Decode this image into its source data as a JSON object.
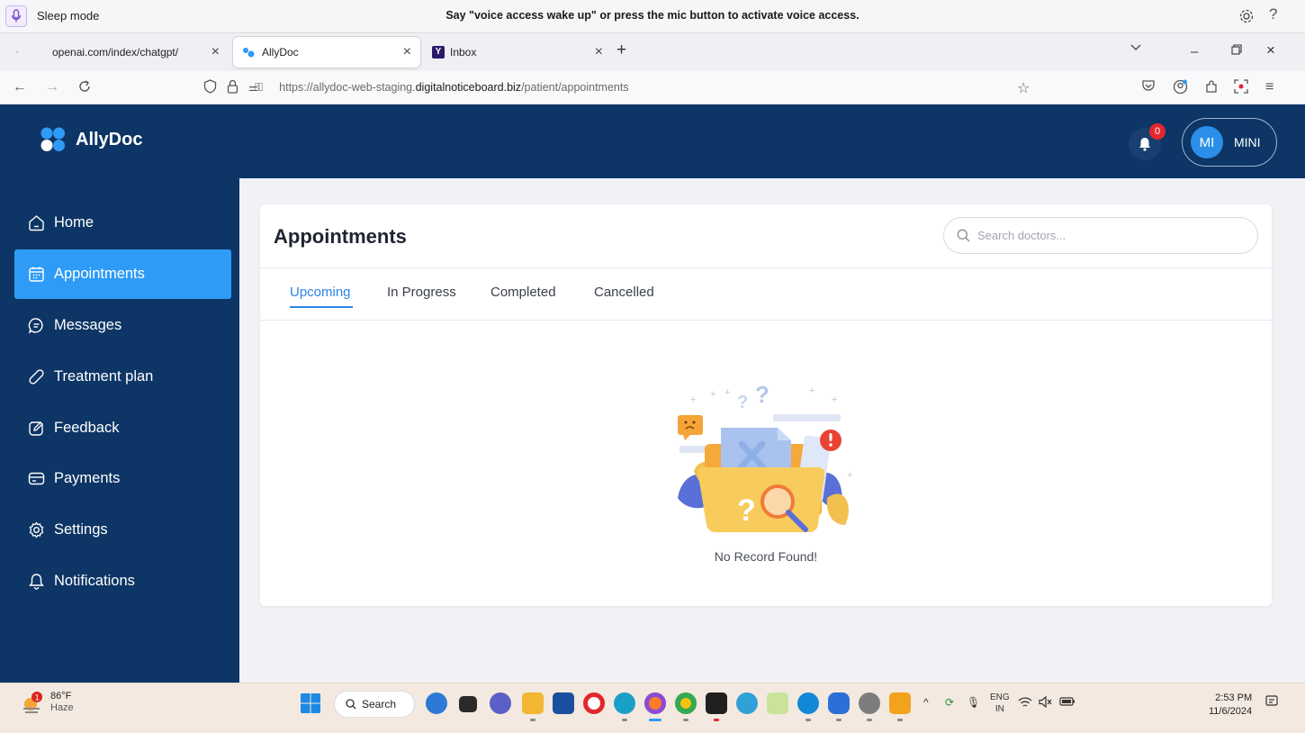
{
  "voice_bar": {
    "mode": "Sleep mode",
    "message": "Say \"voice access wake up\" or press the mic button to activate voice access.",
    "help": "?"
  },
  "browser": {
    "tabs": [
      {
        "label": "openai.com/index/chatgpt/",
        "active": false
      },
      {
        "label": "AllyDoc",
        "active": true
      },
      {
        "label": "Inbox",
        "active": false
      }
    ],
    "url_prefix": "https://allydoc-web-staging.",
    "url_domain": "digitalnoticeboard.biz",
    "url_path": "/patient/appointments"
  },
  "app": {
    "name": "AllyDoc",
    "notification_count": "0",
    "user_initials": "MI",
    "user_name": "MINI"
  },
  "sidebar": {
    "items": [
      {
        "label": "Home",
        "icon": "home-icon",
        "active": false
      },
      {
        "label": "Appointments",
        "icon": "calendar-icon",
        "active": true
      },
      {
        "label": "Messages",
        "icon": "message-icon",
        "active": false
      },
      {
        "label": "Treatment plan",
        "icon": "pill-icon",
        "active": false
      },
      {
        "label": "Feedback",
        "icon": "feedback-icon",
        "active": false
      },
      {
        "label": "Payments",
        "icon": "card-icon",
        "active": false
      },
      {
        "label": "Settings",
        "icon": "gear-icon",
        "active": false
      },
      {
        "label": "Notifications",
        "icon": "bell-icon",
        "active": false
      }
    ]
  },
  "main": {
    "title": "Appointments",
    "search_placeholder": "Search doctors...",
    "tabs": [
      {
        "label": "Upcoming",
        "active": true
      },
      {
        "label": "In Progress",
        "active": false
      },
      {
        "label": "Completed",
        "active": false
      },
      {
        "label": "Cancelled",
        "active": false
      }
    ],
    "empty_message": "No Record Found!"
  },
  "taskbar": {
    "weather_temp": "86°F",
    "weather_desc": "Haze",
    "weather_badge": "1",
    "search_label": "Search",
    "language": "ENG",
    "region": "IN",
    "time": "2:53 PM",
    "date": "11/6/2024"
  },
  "colors": {
    "primary_dark": "#0d3565",
    "accent_blue": "#2e9bf6",
    "tab_active": "#2a86e6",
    "badge_red": "#e5262c"
  }
}
